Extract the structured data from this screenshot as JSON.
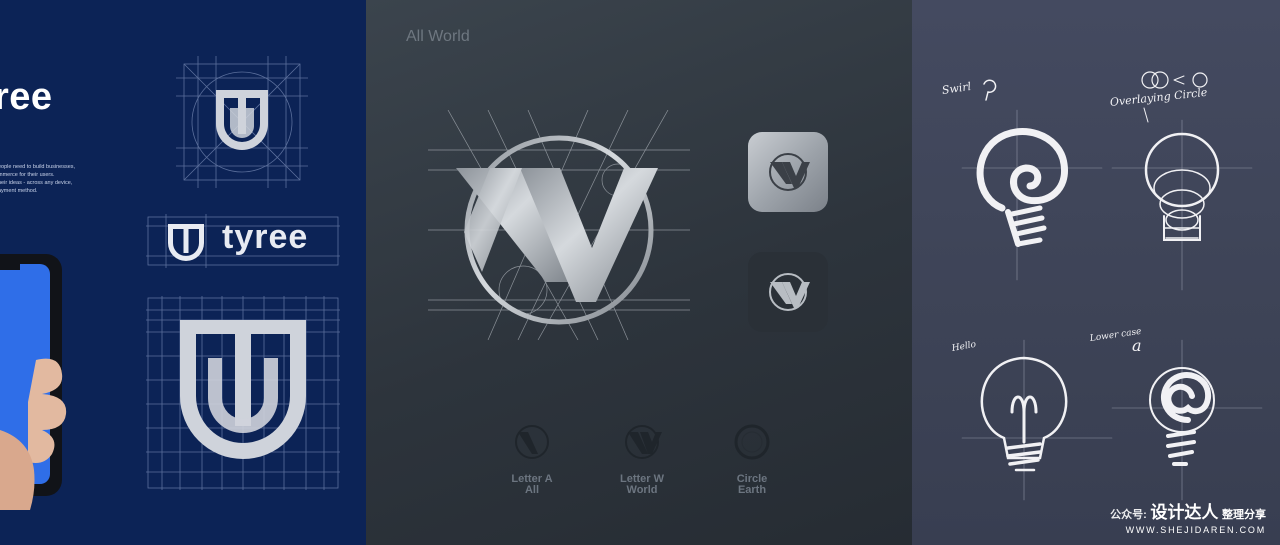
{
  "panels": {
    "tyree": {
      "brand_name": "ree",
      "description_lines": [
        "eople need to build businesses,",
        "mmerce for their users.",
        "heir ideas - across any device,",
        "ayment method."
      ],
      "wordmark": "tyree",
      "colors": {
        "background": "#0c2356",
        "accent": "#2f6ee8",
        "mark": "#cfd3db"
      }
    },
    "allworld": {
      "title": "All World",
      "variants": [
        {
          "line1": "Letter A",
          "line2": "All"
        },
        {
          "line1": "Letter W",
          "line2": "World"
        },
        {
          "line1": "Circle",
          "line2": "Earth"
        }
      ],
      "colors": {
        "background": "#2f363e",
        "silver": "#b9bec4"
      }
    },
    "sketch": {
      "notes": {
        "swirl": "Swirl",
        "overlapping_circle": "Overlaying Circle",
        "hello": "Hello",
        "lower_case": "Lower case",
        "letter_a": "a"
      },
      "colors": {
        "background": "#40465a",
        "chalk": "#f2f2f4"
      }
    }
  },
  "watermark": {
    "prefix": "公众号:",
    "name": "设计达人",
    "suffix": "整理分享",
    "url": "WWW.SHEJIDAREN.COM"
  }
}
